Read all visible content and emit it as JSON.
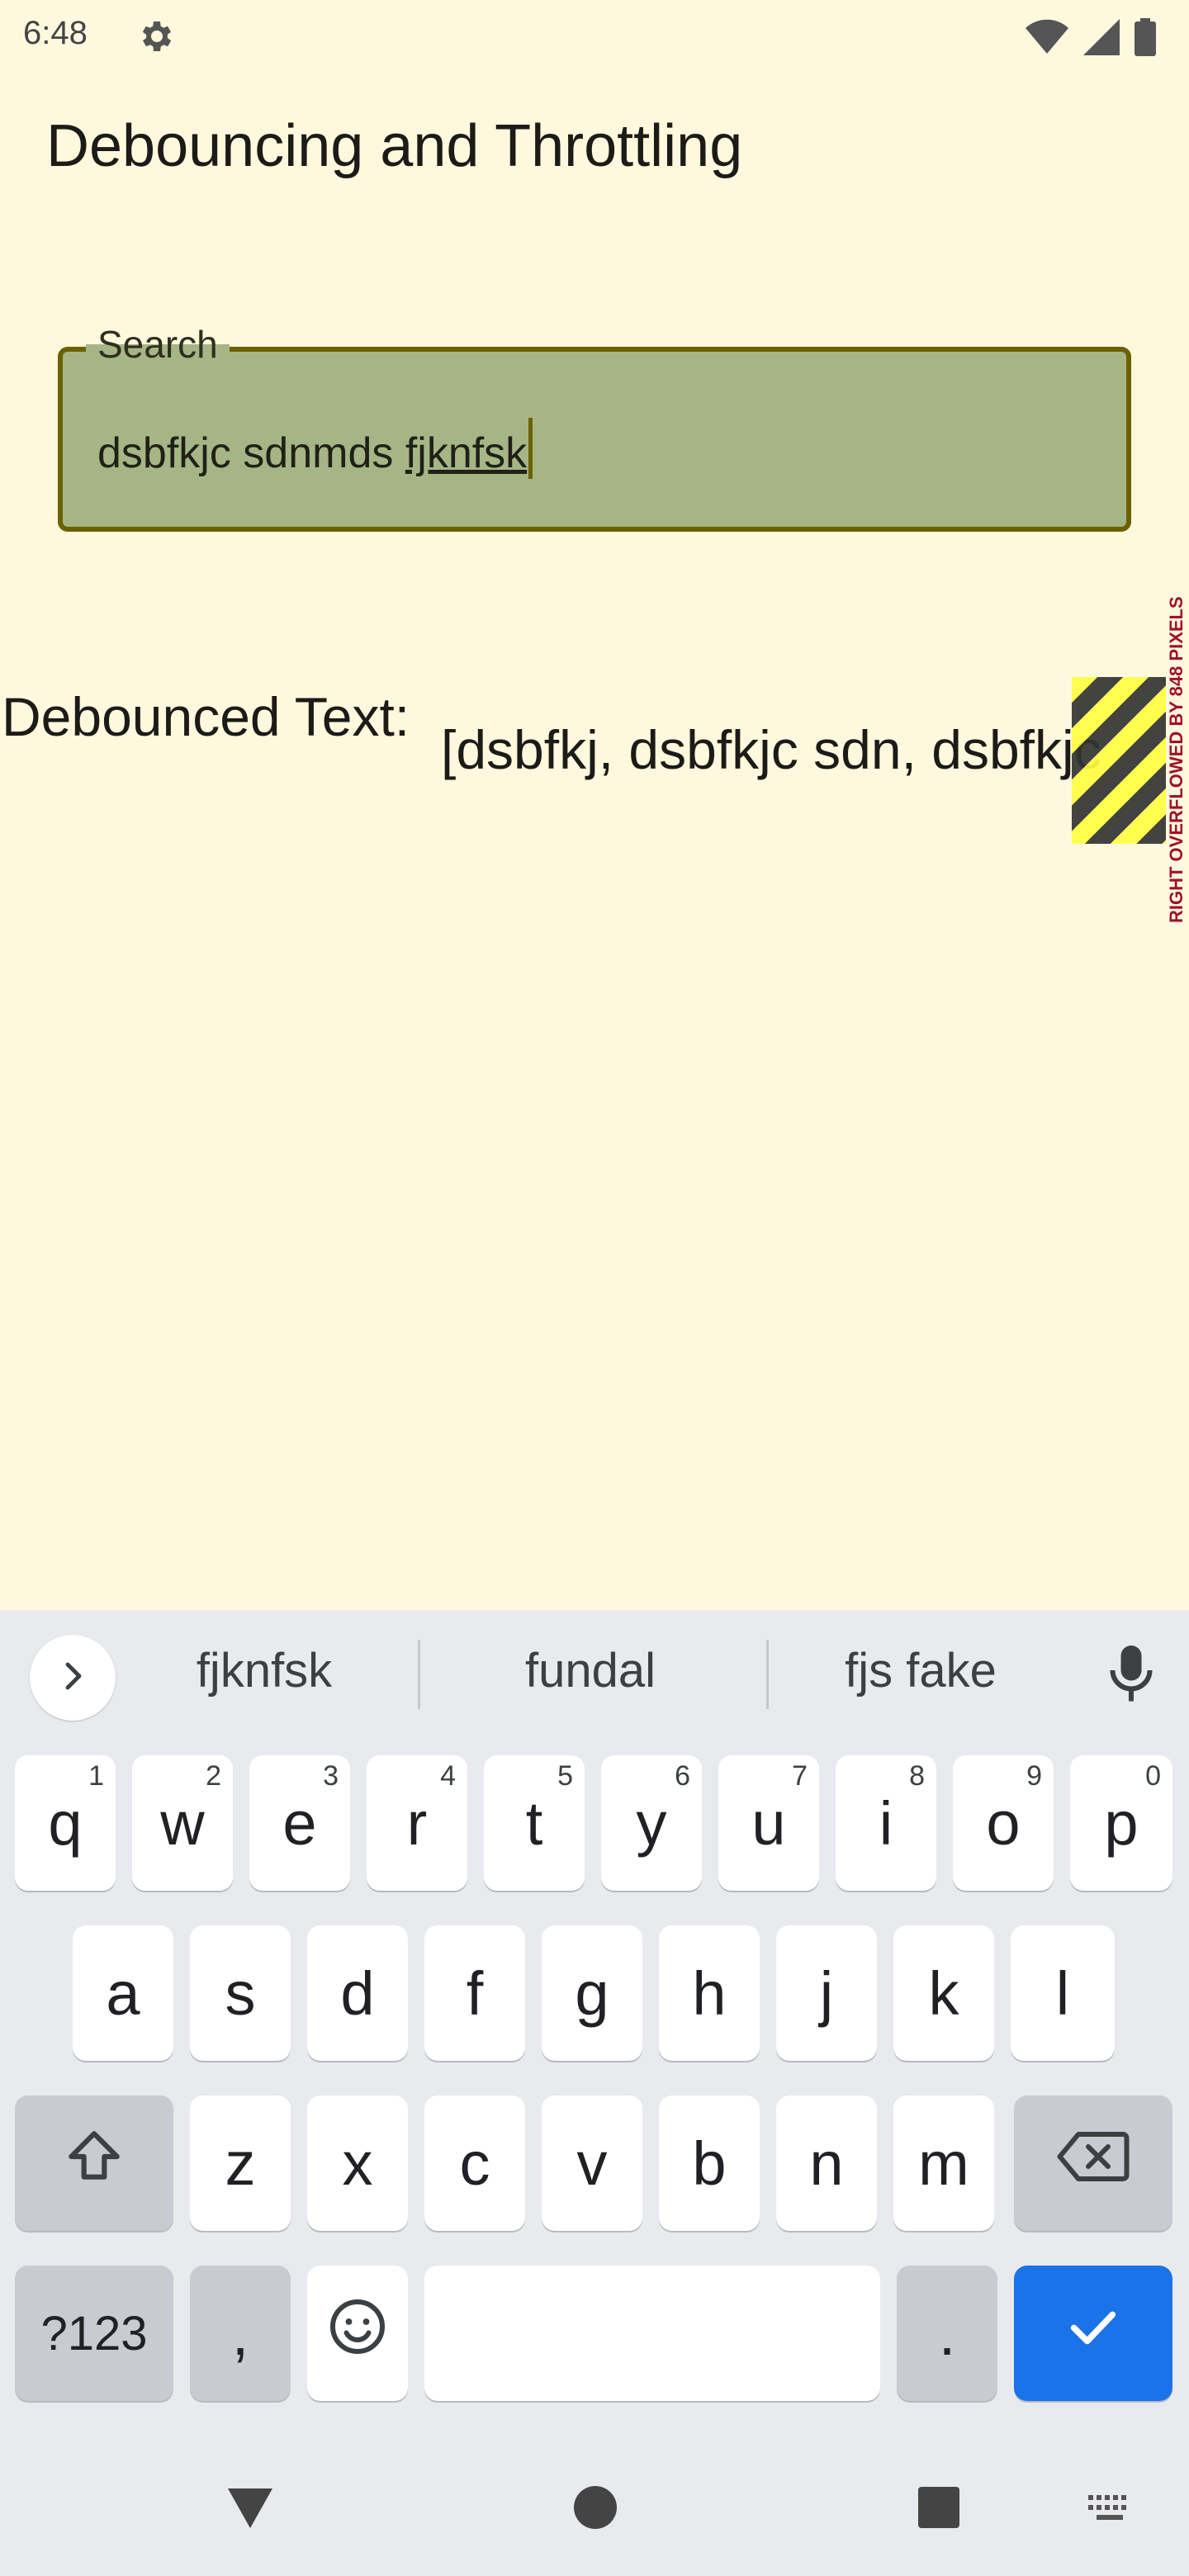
{
  "status_bar": {
    "time": "6:48"
  },
  "app_bar": {
    "title": "Debouncing and Throttling"
  },
  "search": {
    "label": "Search",
    "value_plain": "dsbfkjc sdnmds ",
    "value_composing": "fjknfsk"
  },
  "debounced": {
    "label": "Debounced Text:",
    "value": "[dsbfkj, dsbfkjc sdn, dsbfkjc"
  },
  "overflow_warning": "RIGHT OVERFLOWED BY 848 PIXELS",
  "keyboard": {
    "suggestions": [
      "fjknfsk",
      "fundal",
      "fjs fake"
    ],
    "row1": [
      "q",
      "w",
      "e",
      "r",
      "t",
      "y",
      "u",
      "i",
      "o",
      "p"
    ],
    "row1_hints": [
      "1",
      "2",
      "3",
      "4",
      "5",
      "6",
      "7",
      "8",
      "9",
      "0"
    ],
    "row2": [
      "a",
      "s",
      "d",
      "f",
      "g",
      "h",
      "j",
      "k",
      "l"
    ],
    "row3": [
      "z",
      "x",
      "c",
      "v",
      "b",
      "n",
      "m"
    ],
    "symbols_key": "?123",
    "comma_key": ",",
    "period_key": "."
  },
  "colors": {
    "background": "#fef9de",
    "field_fill": "#a6b585",
    "field_border": "#6a6200",
    "action_key": "#1a73e8"
  }
}
